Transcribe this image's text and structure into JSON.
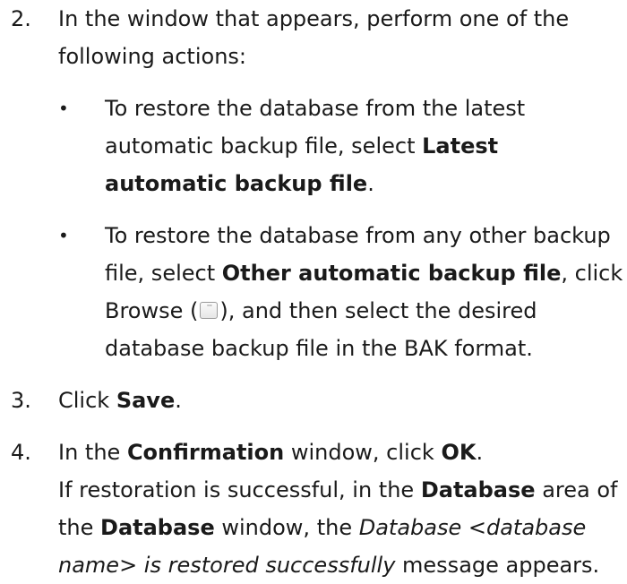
{
  "steps": [
    {
      "number": "2.",
      "text": "In the window that appears, perform one of the following actions:",
      "bullets": [
        {
          "mark": "•",
          "t1": "To restore the database from the latest automatic backup file, select ",
          "b1": "Latest automatic backup file",
          "t2": "."
        },
        {
          "mark": "•",
          "t1": "To restore the database from any other backup file, select ",
          "b1": "Other automatic backup file",
          "t2": ", click Browse (",
          "icon": "browse-button-icon",
          "t3": "), and then select the desired database backup file in the BAK format."
        }
      ]
    },
    {
      "number": "3.",
      "t1": "Click ",
      "b1": "Save",
      "t2": "."
    },
    {
      "number": "4.",
      "t1": "In the ",
      "b1": "Confirmation",
      "t2": " window, click ",
      "b2": "OK",
      "t3": ".",
      "result": {
        "t1": "If restoration is successful, in the ",
        "b1": "Database",
        "t2": " area of the ",
        "b2": "Database",
        "t3": " window, the ",
        "i1": "Database <database name> is restored successfully",
        "t4": " message appears."
      }
    }
  ]
}
